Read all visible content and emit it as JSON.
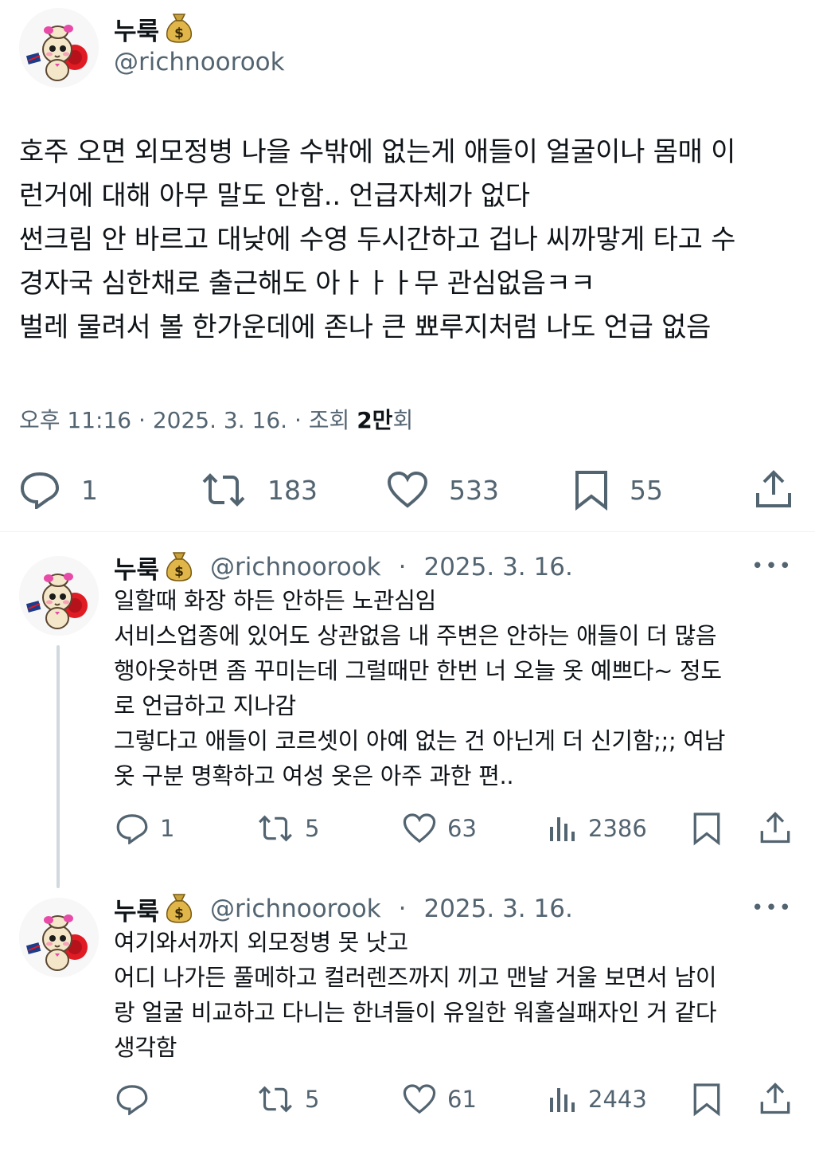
{
  "main_tweet": {
    "author_name": "누룩",
    "author_handle": "@richnoorook",
    "body": "호주 오면 외모정병 나을 수밖에 없는게 애들이 얼굴이나 몸매 이\n런거에 대해 아무 말도 안함.. 언급자체가 없다\n썬크림 안 바르고 대낮에 수영 두시간하고 겁나 씨까맣게 타고 수\n경자국 심한채로 출근해도 아ㅏㅏㅏ무 관심없음ㅋㅋ\n벌레 물려서 볼 한가운데에 존나 큰 뾰루지처럼 나도 언급 없음",
    "time": "오후 11:16",
    "date": "2025. 3. 16.",
    "views_prefix": "조회",
    "views_count": "2만",
    "views_suffix": "회",
    "replies": "1",
    "retweets": "183",
    "likes": "533",
    "bookmarks": "55"
  },
  "replies": [
    {
      "author_name": "누룩",
      "author_handle": "@richnoorook",
      "date": "2025. 3. 16.",
      "more": "•••",
      "body": "일할때 화장 하든 안하든 노관심임\n서비스업종에 있어도 상관없음 내 주변은 안하는 애들이 더 많음\n행아웃하면 좀 꾸미는데 그럴때만 한번 너 오늘 옷 예쁘다~ 정도\n로 언급하고 지나감\n그렇다고 애들이 코르셋이 아예 없는 건 아닌게 더 신기함;;; 여남\n옷 구분 명확하고 여성 옷은 아주 과한 편..",
      "replies": "1",
      "retweets": "5",
      "likes": "63",
      "views": "2386"
    },
    {
      "author_name": "누룩",
      "author_handle": "@richnoorook",
      "date": "2025. 3. 16.",
      "more": "•••",
      "body": "여기와서까지 외모정병 못 낫고\n어디 나가든 풀메하고 컬러렌즈까지 끼고 맨날 거울 보면서 남이\n랑 얼굴 비교하고 다니는 한녀들이 유일한 워홀실패자인 거 같다\n생각함",
      "replies": "",
      "retweets": "5",
      "likes": "61",
      "views": "2443"
    }
  ],
  "colors": {
    "text": "#0f1419",
    "secondary": "#536471",
    "divider": "#eff3f4",
    "thread_line": "#cfd9de"
  }
}
